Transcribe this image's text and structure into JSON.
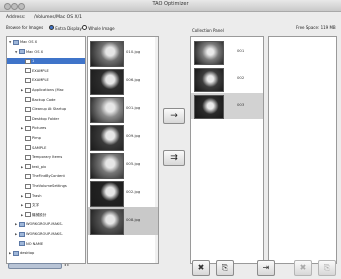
{
  "window": {
    "title": "TAO Optimizer"
  },
  "address": {
    "label": "Address:",
    "value": "/Volumes/Mac OS X/1"
  },
  "options": {
    "browse_label": "Browse for Images",
    "radio_display": "Extra Display",
    "radio_whole": "Whole Image"
  },
  "collection_label": "Collection Panel",
  "free_space": "Free Space: 119 MB",
  "tree": {
    "items": [
      {
        "label": "Mac OS X",
        "level": 0,
        "arrow": "▼"
      },
      {
        "label": "Mac OS X",
        "level": 1,
        "arrow": "▼"
      },
      {
        "label": "1",
        "level": 2,
        "arrow": "",
        "selected": true
      },
      {
        "label": "EXAMPLE",
        "level": 2,
        "arrow": ""
      },
      {
        "label": "EXAMPLE",
        "level": 2,
        "arrow": ""
      },
      {
        "label": "Applications (Mac",
        "level": 2,
        "arrow": "▶"
      },
      {
        "label": "Backup Code",
        "level": 2,
        "arrow": ""
      },
      {
        "label": "Cleanup At Startup",
        "level": 2,
        "arrow": ""
      },
      {
        "label": "Desktop Folder",
        "level": 2,
        "arrow": ""
      },
      {
        "label": "Pictures",
        "level": 2,
        "arrow": "▶"
      },
      {
        "label": "Pimp",
        "level": 2,
        "arrow": ""
      },
      {
        "label": "SAMPLE",
        "level": 2,
        "arrow": ""
      },
      {
        "label": "Temporary Items",
        "level": 2,
        "arrow": ""
      },
      {
        "label": "test_pix",
        "level": 2,
        "arrow": "▶"
      },
      {
        "label": "TheFindByContent",
        "level": 2,
        "arrow": ""
      },
      {
        "label": "TheVolumeSettings",
        "level": 2,
        "arrow": ""
      },
      {
        "label": "Trash",
        "level": 2,
        "arrow": "▶"
      },
      {
        "label": "文字",
        "level": 2,
        "arrow": "▶"
      },
      {
        "label": "機械設計",
        "level": 2,
        "arrow": "▶"
      },
      {
        "label": "WORKGROUP-MAKS-",
        "level": 1,
        "arrow": "▶"
      },
      {
        "label": "WORKGROUP-MAKS-",
        "level": 1,
        "arrow": "▶"
      },
      {
        "label": "NO NAME",
        "level": 1,
        "arrow": ""
      },
      {
        "label": "desktop",
        "level": 0,
        "arrow": "▶"
      }
    ]
  },
  "thumbnails": {
    "items": [
      {
        "name": "010.jpg",
        "color": "#6f6f6f"
      },
      {
        "name": "006.jpg",
        "color": "#2d2d2d"
      },
      {
        "name": "001.jpg",
        "color": "#8a8a8a"
      },
      {
        "name": "009.jpg",
        "color": "#3a3a3a"
      },
      {
        "name": "005.jpg",
        "color": "#777777"
      },
      {
        "name": "002.jpg",
        "color": "#222222"
      },
      {
        "name": "008.jpg",
        "color": "#555555",
        "selected": true
      }
    ]
  },
  "collection": {
    "items": [
      {
        "name": "001",
        "color": "#7a7a7a"
      },
      {
        "name": "002",
        "color": "#3c3c3c"
      },
      {
        "name": "003",
        "color": "#2a2a2a",
        "selected": true
      }
    ]
  },
  "buttons": {
    "move_right": "→",
    "move_all": "⇉",
    "delete": "✖",
    "copy": "⎘",
    "export": "⇥",
    "clear": "✖",
    "duplicate": "⎘"
  }
}
